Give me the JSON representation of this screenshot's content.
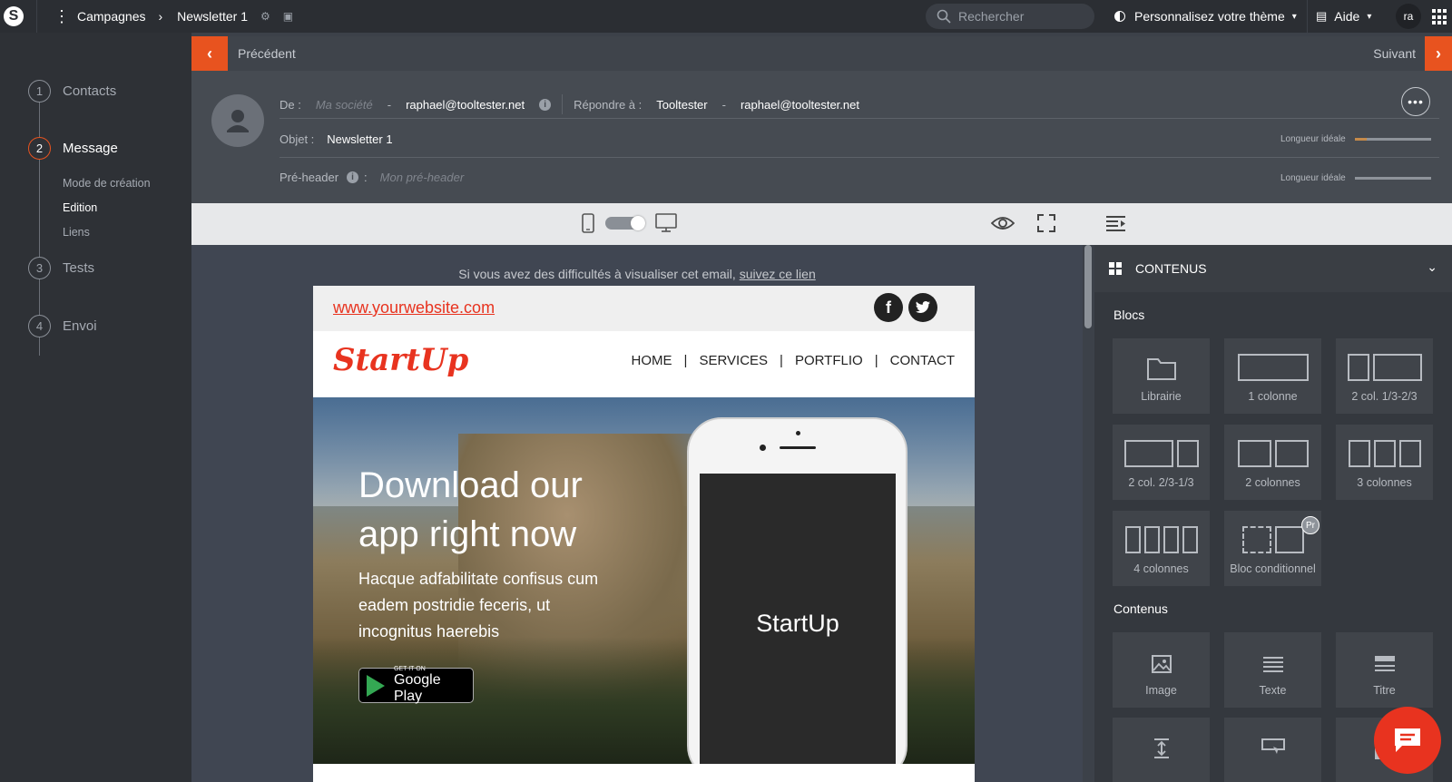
{
  "topbar": {
    "breadcrumb_1": "Campagnes",
    "breadcrumb_2": "Newsletter 1",
    "search_placeholder": "Rechercher",
    "theme_label": "Personnalisez votre thème",
    "help_label": "Aide",
    "user_initials": "ra"
  },
  "steps": [
    {
      "num": "1",
      "label": "Contacts"
    },
    {
      "num": "2",
      "label": "Message"
    },
    {
      "num": "3",
      "label": "Tests"
    },
    {
      "num": "4",
      "label": "Envoi"
    }
  ],
  "substeps": [
    "Mode de création",
    "Edition",
    "Liens"
  ],
  "nav": {
    "prev": "Précédent",
    "next": "Suivant"
  },
  "header": {
    "from_label": "De :",
    "from_name_placeholder": "Ma société",
    "from_email": "raphael@tooltester.net",
    "reply_label": "Répondre à :",
    "reply_name": "Tooltester",
    "reply_email": "raphael@tooltester.net",
    "subject_label": "Objet :",
    "subject_value": "Newsletter 1",
    "preheader_label": "Pré-header",
    "preheader_placeholder": "Mon pré-header",
    "ideal_length": "Longueur idéale",
    "subject_length_fraction": 0.16,
    "preheader_length_fraction": 0
  },
  "canvas": {
    "view_text": "Si vous avez des difficultés à visualiser cet email,",
    "view_link": "suivez ce lien"
  },
  "email": {
    "website": "www.yourwebsite.com",
    "logo": "StartUp",
    "nav": [
      "HOME",
      "SERVICES",
      "PORTFLIO",
      "CONTACT"
    ],
    "hero_title": "Download our app right now",
    "hero_text": "Hacque adfabilitate confisus cum eadem postridie feceris, ut incognitus haerebis",
    "gplay_small": "GET IT ON",
    "gplay_big": "Google Play",
    "phone_screen": "StartUp"
  },
  "panel": {
    "header": "CONTENUS",
    "blocs_title": "Blocs",
    "blocs": [
      "Librairie",
      "1 colonne",
      "2 col. 1/3-2/3",
      "2 col. 2/3-1/3",
      "2 colonnes",
      "3 colonnes",
      "4 colonnes",
      "Bloc conditionnel"
    ],
    "pro_badge": "Pr",
    "contenus_title": "Contenus",
    "contenus": [
      "Image",
      "Texte",
      "Titre"
    ]
  },
  "colors": {
    "accent": "#e8531f",
    "email_red": "#e8331f"
  }
}
